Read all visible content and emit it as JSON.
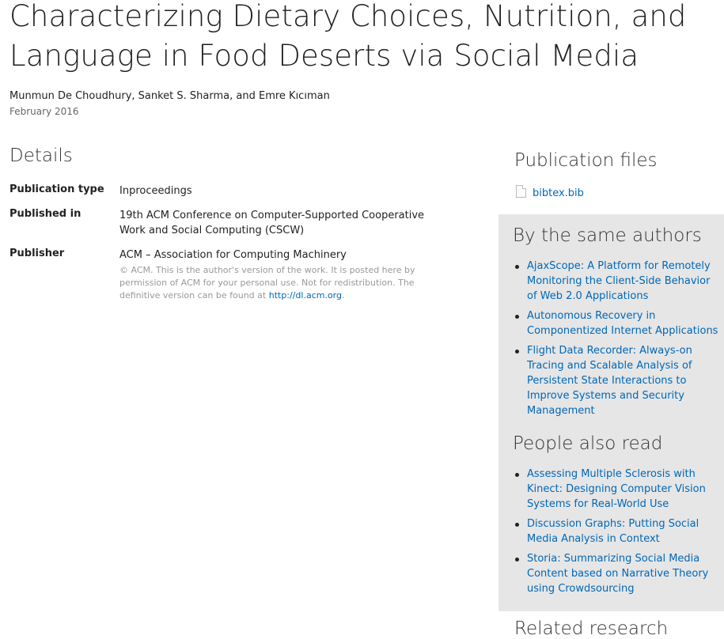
{
  "page": {
    "title": "Characterizing Dietary Choices, Nutrition, and Language in Food Deserts via Social Media",
    "authors": "Munmun De Choudhury, Sanket S. Sharma, and Emre Kıcıman",
    "date": "February 2016"
  },
  "details": {
    "heading": "Details",
    "rows": [
      {
        "label": "Publication type",
        "value": "Inproceedings"
      },
      {
        "label": "Published in",
        "value": "19th ACM Conference on Computer-Supported Cooperative Work and Social Computing (CSCW)"
      },
      {
        "label": "Publisher",
        "value": "ACM – Association for Computing Machinery"
      }
    ],
    "publisher_note": "© ACM. This is the author's version of the work. It is posted here by permission of ACM for your personal use. Not for redistribution. The definitive version can be found at",
    "publisher_link": "http://dl.acm.org",
    "publisher_note_end": "."
  },
  "files": {
    "heading": "Publication files",
    "items": [
      {
        "name": "bibtex.bib",
        "icon": "file-icon"
      }
    ]
  },
  "same_authors": {
    "heading": "By the same authors",
    "items": [
      "AjaxScope: A Platform for Remotely Monitoring the Client-Side Behavior of Web 2.0 Applications",
      "Autonomous Recovery in Componentized Internet Applications",
      "Flight Data Recorder: Always-on Tracing and Scalable Analysis of Persistent State Interactions to Improve Systems and Security Management"
    ]
  },
  "also_read": {
    "heading": "People also read",
    "items": [
      "Assessing Multiple Sclerosis with Kinect: Designing Computer Vision Systems for Real-World Use",
      "Discussion Graphs: Putting Social Media Analysis in Context",
      "Storia: Summarizing Social Media Content based on Narrative Theory using Crowdsourcing"
    ]
  },
  "related": {
    "heading": "Related research"
  },
  "colors": {
    "link": "#0067b8",
    "panel_bg": "#e6e6e6"
  }
}
